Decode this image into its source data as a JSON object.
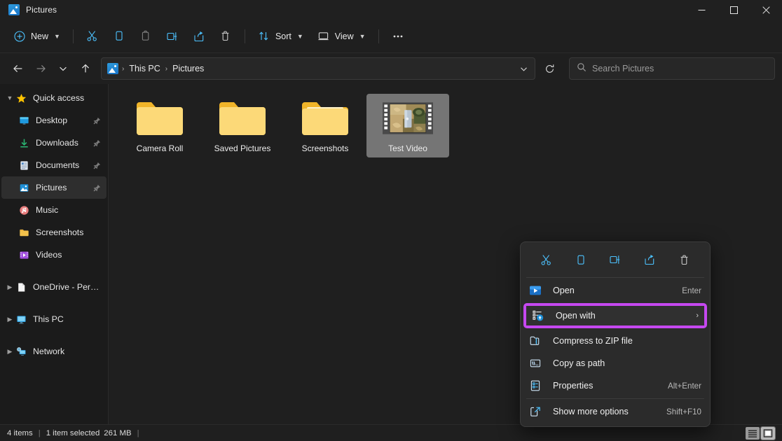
{
  "window": {
    "title": "Pictures",
    "app_icon": "pictures-folder-icon",
    "controls": {
      "minimize": "Minimize",
      "maximize": "Maximize",
      "close": "Close"
    }
  },
  "toolbar": {
    "new_label": "New",
    "buttons": [
      {
        "name": "cut",
        "label": "Cut"
      },
      {
        "name": "copy",
        "label": "Copy"
      },
      {
        "name": "paste",
        "label": "Paste"
      },
      {
        "name": "rename",
        "label": "Rename"
      },
      {
        "name": "share",
        "label": "Share"
      },
      {
        "name": "delete",
        "label": "Delete"
      }
    ],
    "sort_label": "Sort",
    "view_label": "View",
    "more_label": "See more"
  },
  "addressbar": {
    "back": "Back",
    "forward": "Forward",
    "recent": "Recent locations",
    "up": "Up to This PC",
    "crumbs": [
      "This PC",
      "Pictures"
    ],
    "separator": "›",
    "refresh": "Refresh"
  },
  "search": {
    "placeholder": "Search Pictures",
    "icon": "search-icon"
  },
  "sidebar": {
    "groups": [
      {
        "name": "quick-access",
        "label": "Quick access",
        "icon": "star-icon",
        "expanded": true,
        "items": [
          {
            "label": "Desktop",
            "icon": "desktop-icon",
            "pinned": true,
            "selected": false
          },
          {
            "label": "Downloads",
            "icon": "download-icon",
            "pinned": true,
            "selected": false
          },
          {
            "label": "Documents",
            "icon": "documents-icon",
            "pinned": true,
            "selected": false
          },
          {
            "label": "Pictures",
            "icon": "pictures-icon",
            "pinned": true,
            "selected": true
          },
          {
            "label": "Music",
            "icon": "music-icon",
            "pinned": false,
            "selected": false
          },
          {
            "label": "Screenshots",
            "icon": "folder-icon",
            "pinned": false,
            "selected": false
          },
          {
            "label": "Videos",
            "icon": "videos-icon",
            "pinned": false,
            "selected": false
          }
        ]
      },
      {
        "name": "onedrive",
        "label": "OneDrive - Personal",
        "icon": "onedrive-icon",
        "expanded": false,
        "items": []
      },
      {
        "name": "this-pc",
        "label": "This PC",
        "icon": "monitor-icon",
        "expanded": false,
        "items": []
      },
      {
        "name": "network",
        "label": "Network",
        "icon": "network-icon",
        "expanded": false,
        "items": []
      }
    ]
  },
  "files": [
    {
      "label": "Camera Roll",
      "icon": "folder-icon",
      "selected": false
    },
    {
      "label": "Saved Pictures",
      "icon": "folder-icon",
      "selected": false
    },
    {
      "label": "Screenshots",
      "icon": "folder-open-icon",
      "selected": false
    },
    {
      "label": "Test Video",
      "icon": "video-thumbnail",
      "selected": true
    }
  ],
  "context_menu": {
    "toolbar_icons": [
      {
        "name": "cut-icon",
        "label": "Cut"
      },
      {
        "name": "copy-icon",
        "label": "Copy"
      },
      {
        "name": "rename-icon",
        "label": "Rename"
      },
      {
        "name": "share-icon",
        "label": "Share"
      },
      {
        "name": "delete-icon",
        "label": "Delete"
      }
    ],
    "items": [
      {
        "label": "Open",
        "accel": "Enter",
        "icon": "media-player-icon",
        "highlighted": false,
        "submenu": false
      },
      {
        "label": "Open with",
        "accel": "",
        "icon": "open-with-icon",
        "highlighted": true,
        "submenu": true
      },
      {
        "label": "Compress to ZIP file",
        "accel": "",
        "icon": "zip-icon",
        "highlighted": false,
        "submenu": false
      },
      {
        "label": "Copy as path",
        "accel": "",
        "icon": "copy-path-icon",
        "highlighted": false,
        "submenu": false
      },
      {
        "label": "Properties",
        "accel": "Alt+Enter",
        "icon": "properties-icon",
        "highlighted": false,
        "submenu": false
      },
      {
        "label": "Show more options",
        "accel": "Shift+F10",
        "icon": "show-more-icon",
        "highlighted": false,
        "submenu": false
      }
    ],
    "submenu_arrow": "›",
    "highlight_color": "#c548f0"
  },
  "statusbar": {
    "item_count": "4 items",
    "separator": "|",
    "selection": "1 item selected",
    "size": "261 MB",
    "trailing_separator": "|",
    "views": [
      {
        "name": "list-view",
        "active": false
      },
      {
        "name": "large-icons-view",
        "active": true
      }
    ]
  },
  "colors": {
    "window_bg": "#1f1f1f",
    "sidebar_bg": "#1b1b1b",
    "menu_bg": "#2b2b2b",
    "accent_blue": "#4cc2ff",
    "highlight_magenta": "#c548f0",
    "folder_yellow": "#ffc83d"
  }
}
